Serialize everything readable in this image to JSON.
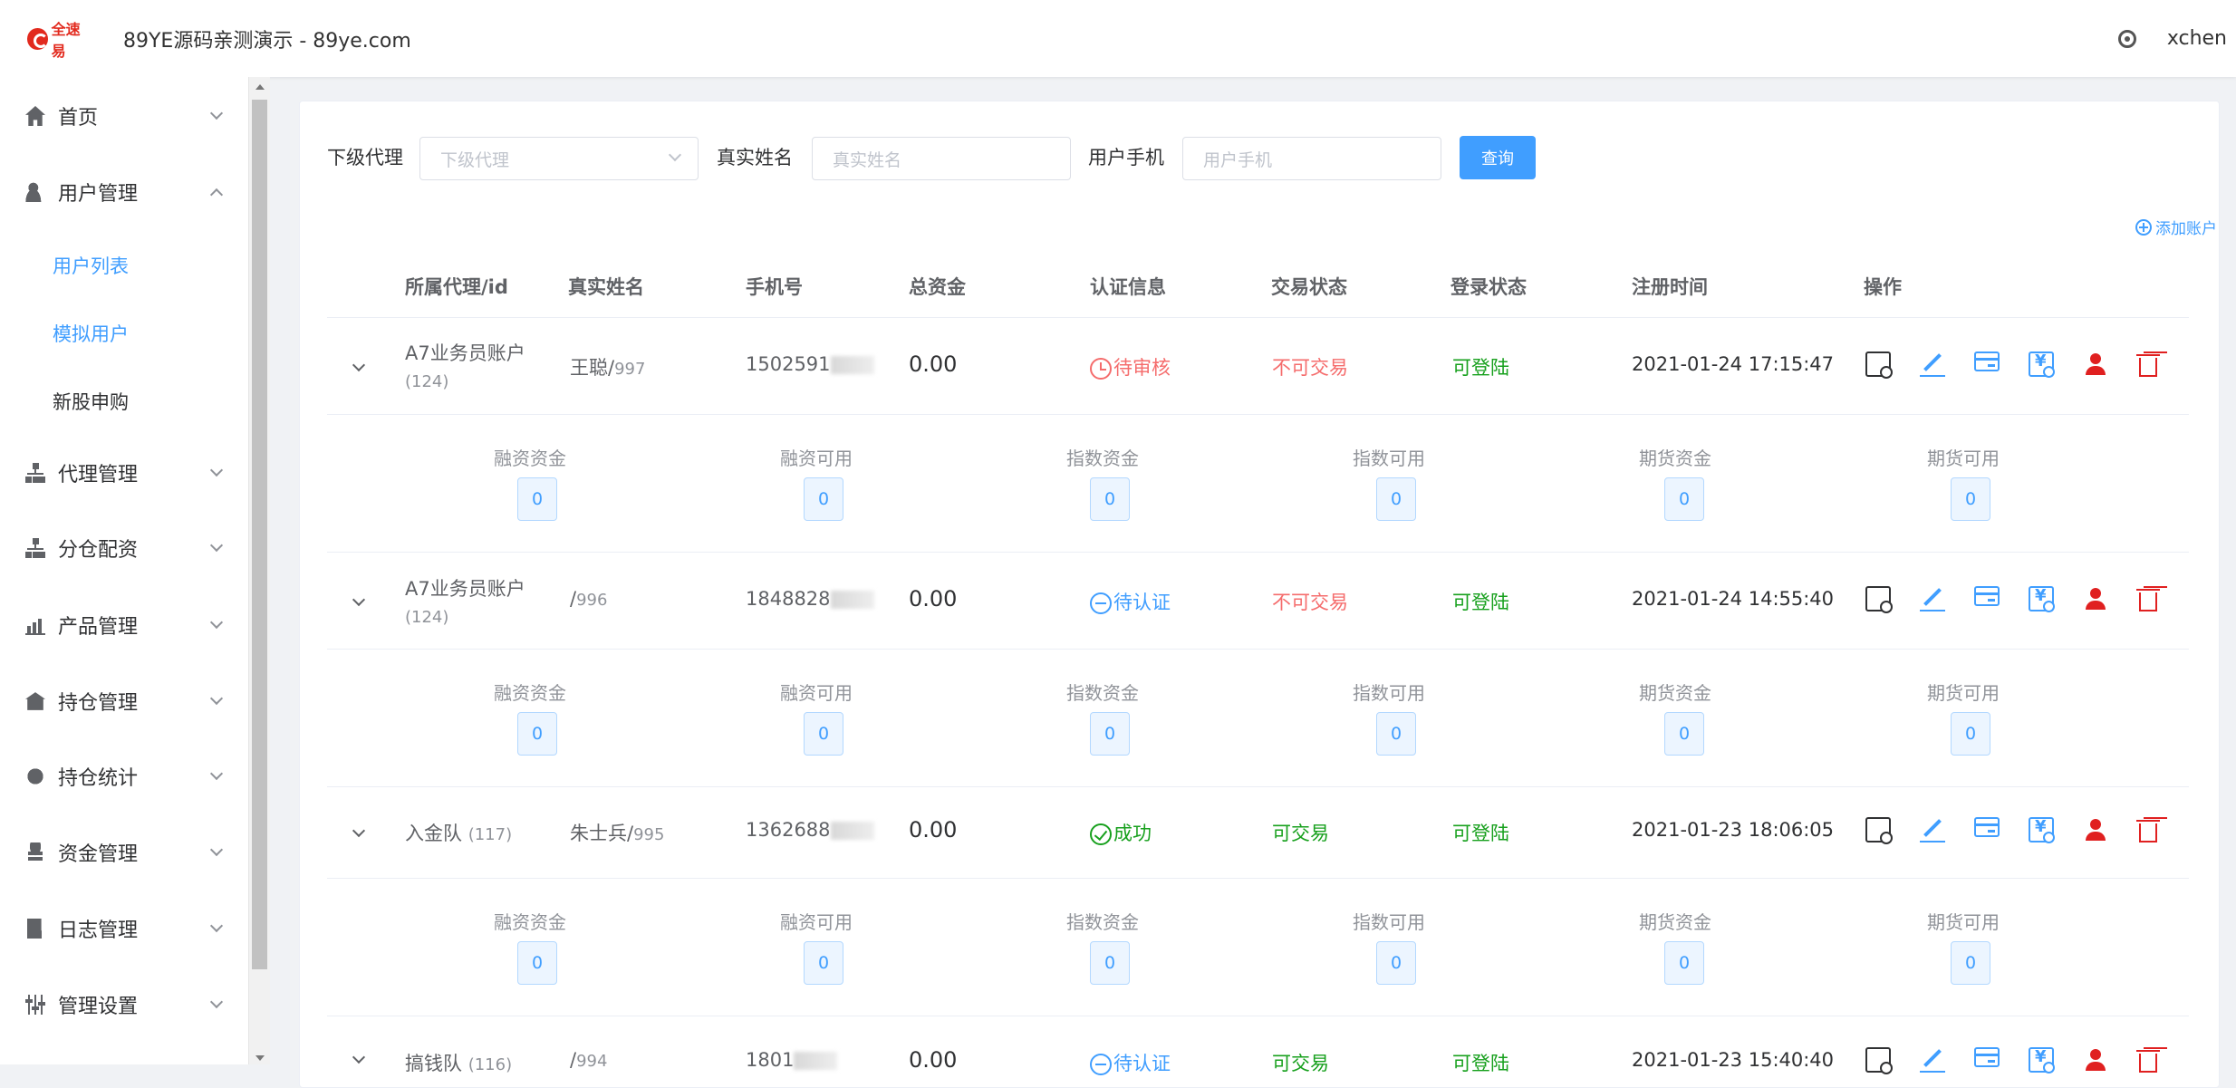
{
  "header": {
    "logo_text": "全速易",
    "title": "89YE源码亲测演示 - 89ye.com",
    "username": "xchen"
  },
  "sidebar": {
    "items": [
      {
        "label": "首页",
        "icon": "home-icon"
      },
      {
        "label": "用户管理",
        "icon": "user-icon",
        "expanded": true,
        "children": [
          {
            "label": "用户列表",
            "active": true
          },
          {
            "label": "模拟用户",
            "active": true
          },
          {
            "label": "新股申购",
            "active": false
          }
        ]
      },
      {
        "label": "代理管理",
        "icon": "org-tree-icon"
      },
      {
        "label": "分仓配资",
        "icon": "org-tree-icon"
      },
      {
        "label": "产品管理",
        "icon": "chart-icon"
      },
      {
        "label": "持仓管理",
        "icon": "house-icon"
      },
      {
        "label": "持仓统计",
        "icon": "stats-icon"
      },
      {
        "label": "资金管理",
        "icon": "coins-icon"
      },
      {
        "label": "日志管理",
        "icon": "log-icon"
      },
      {
        "label": "管理设置",
        "icon": "settings-icon"
      }
    ]
  },
  "filters": {
    "agent_label": "下级代理",
    "agent_placeholder": "下级代理",
    "name_label": "真实姓名",
    "name_placeholder": "真实姓名",
    "phone_label": "用户手机",
    "phone_placeholder": "用户手机",
    "query_button": "查询"
  },
  "add_account": "添加账户",
  "table": {
    "columns": [
      "所属代理/id",
      "真实姓名",
      "手机号",
      "总资金",
      "认证信息",
      "交易状态",
      "登录状态",
      "注册时间",
      "操作"
    ],
    "sub_columns": [
      "融资资金",
      "融资可用",
      "指数资金",
      "指数可用",
      "期货资金",
      "期货可用"
    ],
    "rows": [
      {
        "agent": "A7业务员账户",
        "agent_id": "(124)",
        "name": "王聪",
        "uid": "997",
        "phone": "1502591",
        "funds": "0.00",
        "cert": "待审核",
        "cert_type": "pending",
        "trade": "不可交易",
        "trade_ok": false,
        "login": "可登陆",
        "reg_time": "2021-01-24 17:15:47",
        "sub_values": [
          "0",
          "0",
          "0",
          "0",
          "0",
          "0"
        ]
      },
      {
        "agent": "A7业务员账户",
        "agent_id": "(124)",
        "name": "",
        "uid": "996",
        "phone": "1848828",
        "funds": "0.00",
        "cert": "待认证",
        "cert_type": "wait",
        "trade": "不可交易",
        "trade_ok": false,
        "login": "可登陆",
        "reg_time": "2021-01-24 14:55:40",
        "sub_values": [
          "0",
          "0",
          "0",
          "0",
          "0",
          "0"
        ]
      },
      {
        "agent": "入金队",
        "agent_id": "(117)",
        "name": "朱士兵",
        "uid": "995",
        "phone": "1362688",
        "funds": "0.00",
        "cert": "成功",
        "cert_type": "ok",
        "trade": "可交易",
        "trade_ok": true,
        "login": "可登陆",
        "reg_time": "2021-01-23 18:06:05",
        "sub_values": [
          "0",
          "0",
          "0",
          "0",
          "0",
          "0"
        ]
      },
      {
        "agent": "搞钱队",
        "agent_id": "(116)",
        "name": "",
        "uid": "994",
        "phone": "1801",
        "funds": "0.00",
        "cert": "待认证",
        "cert_type": "wait",
        "trade": "可交易",
        "trade_ok": true,
        "login": "可登陆",
        "reg_time": "2021-01-23 15:40:40"
      }
    ]
  },
  "colors": {
    "primary": "#409eff",
    "danger": "#f56c6c",
    "success": "#17a01d"
  }
}
